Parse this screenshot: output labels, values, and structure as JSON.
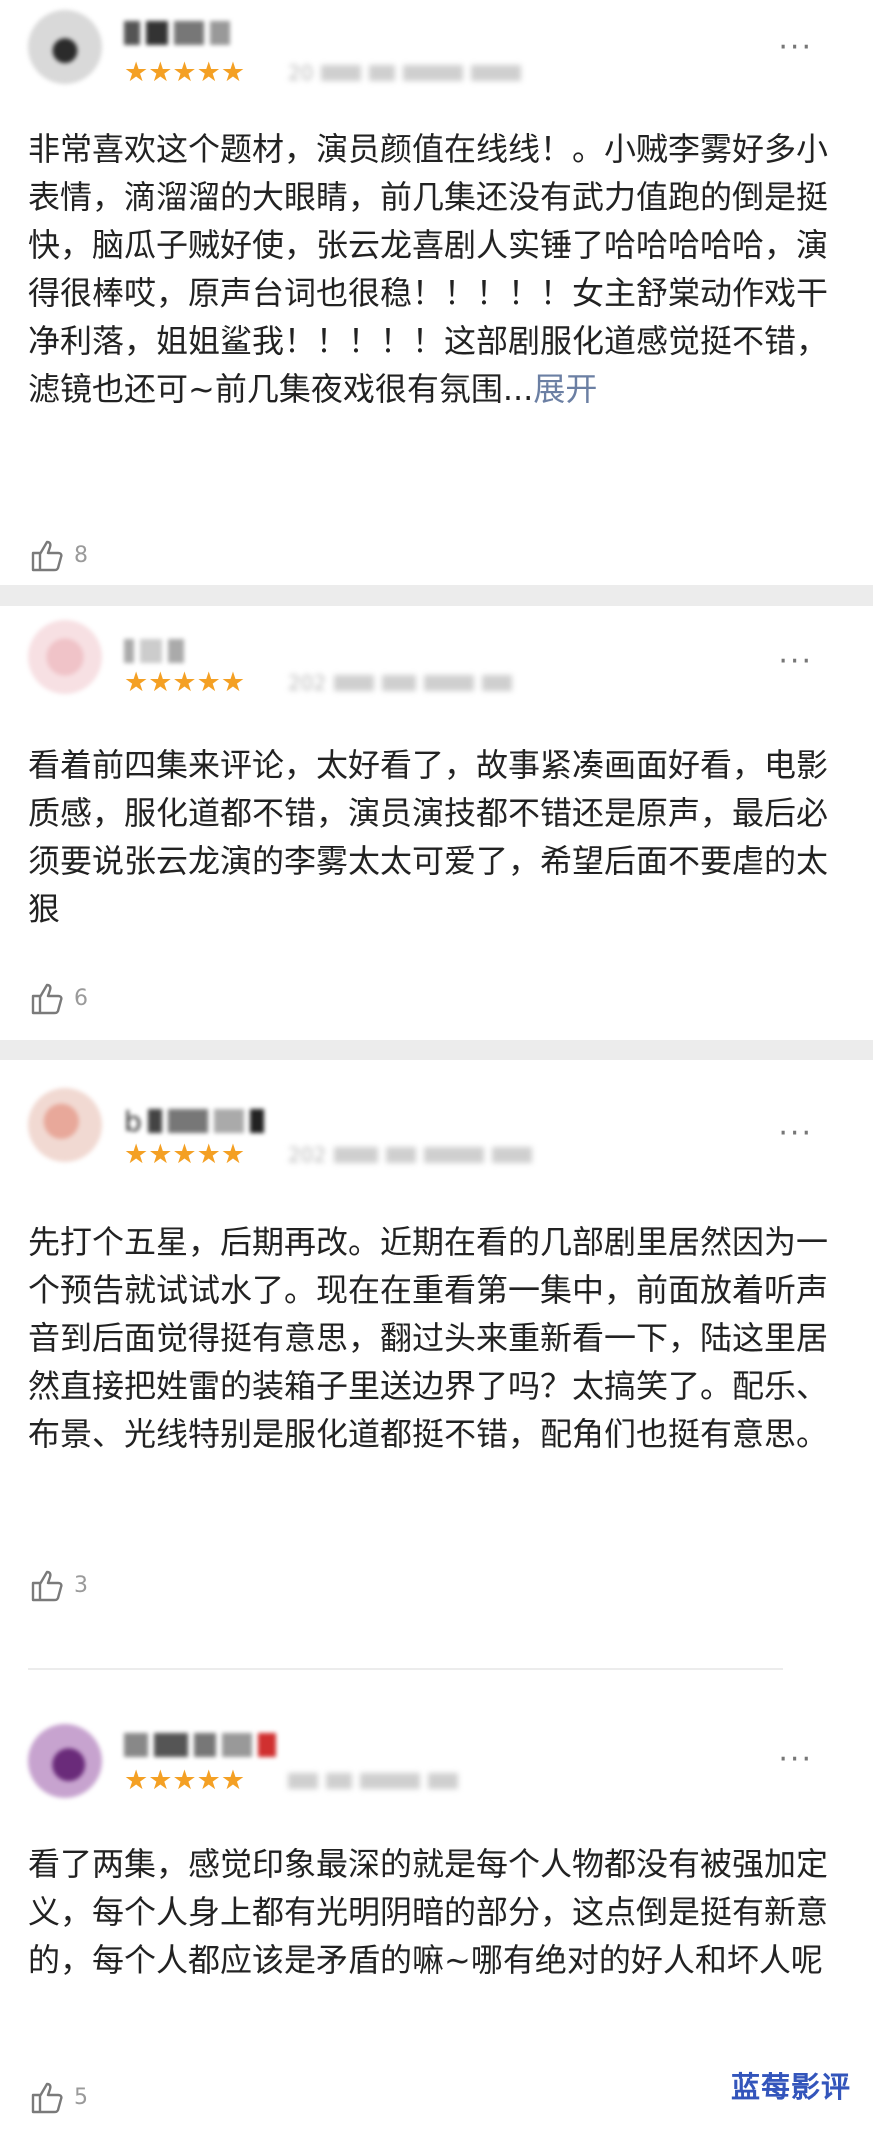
{
  "reviews": [
    {
      "rating": "★★★★★",
      "date": "20",
      "more": "···",
      "text": "非常喜欢这个题材，演员颜值在线线！。小贼李雾好多小表情，滴溜溜的大眼睛，前几集还没有武力值跑的倒是挺快，脑瓜子贼好使，张云龙喜剧人实锤了哈哈哈哈哈，演得很棒哎，原声台词也很稳！！！！！女主舒棠动作戏干净利落，姐姐鲨我！！！！！这部剧服化道感觉挺不错，滤镜也还可~前几集夜戏很有氛围...",
      "expand": "展开",
      "likes": "8"
    },
    {
      "rating": "★★★★★",
      "date": "202",
      "more": "···",
      "text": "看着前四集来评论，太好看了，故事紧凑画面好看，电影质感，服化道都不错，演员演技都不错还是原声，最后必须要说张云龙演的李雾太太可爱了，希望后面不要虐的太狠",
      "likes": "6"
    },
    {
      "name_prefix": "b",
      "rating": "★★★★★",
      "date": "202",
      "more": "···",
      "text": "先打个五星，后期再改。近期在看的几部剧里居然因为一个预告就试试水了。现在在重看第一集中，前面放着听声音到后面觉得挺有意思，翻过头来重新看一下，陆这里居然直接把姓雷的装箱子里送边界了吗？太搞笑了。配乐、布景、光线特别是服化道都挺不错，配角们也挺有意思。",
      "likes": "3"
    },
    {
      "rating": "★★★★★",
      "more": "···",
      "text": "看了两集，感觉印象最深的就是每个人物都没有被强加定义，每个人身上都有光明阴暗的部分，这点倒是挺有新意的，每个人都应该是矛盾的嘛~哪有绝对的好人和坏人呢",
      "likes": "5"
    }
  ],
  "watermark": "蓝莓影评",
  "colors": {
    "star": "#f4a024",
    "expand": "#6b7fa3",
    "separator": "#ececec"
  },
  "icons": {
    "like": "thumbs-up-icon",
    "more": "more-dots-icon"
  }
}
